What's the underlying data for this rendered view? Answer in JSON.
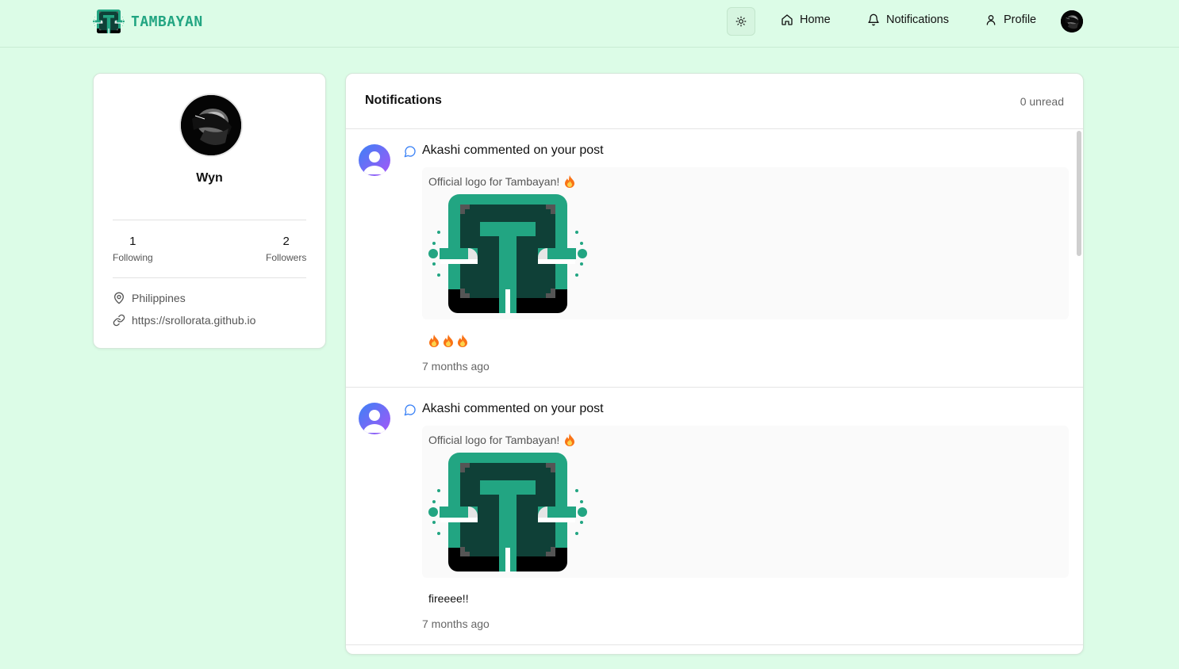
{
  "app": {
    "name": "TAMBAYAN",
    "brand_color": "#22a582",
    "background": "#dcfce7"
  },
  "nav": {
    "theme_toggle_icon": "sun-icon",
    "items": [
      {
        "label": "Home",
        "icon": "home-icon"
      },
      {
        "label": "Notifications",
        "icon": "bell-icon"
      },
      {
        "label": "Profile",
        "icon": "user-icon"
      }
    ]
  },
  "profile": {
    "name": "Wyn",
    "following_count": "1",
    "following_label": "Following",
    "followers_count": "2",
    "followers_label": "Followers",
    "location": "Philippines",
    "website": "https://srollorata.github.io"
  },
  "notifications": {
    "title": "Notifications",
    "unread": "0 unread",
    "items": [
      {
        "type_icon": "comment-icon",
        "text": "Akashi commented on your post",
        "post_caption": "Official logo for Tambayan!",
        "comment": "",
        "comment_emojis": 3,
        "time": "7 months ago"
      },
      {
        "type_icon": "comment-icon",
        "text": "Akashi commented on your post",
        "post_caption": "Official logo for Tambayan!",
        "comment": "fireeee!!",
        "comment_emojis": 0,
        "time": "7 months ago"
      }
    ]
  }
}
